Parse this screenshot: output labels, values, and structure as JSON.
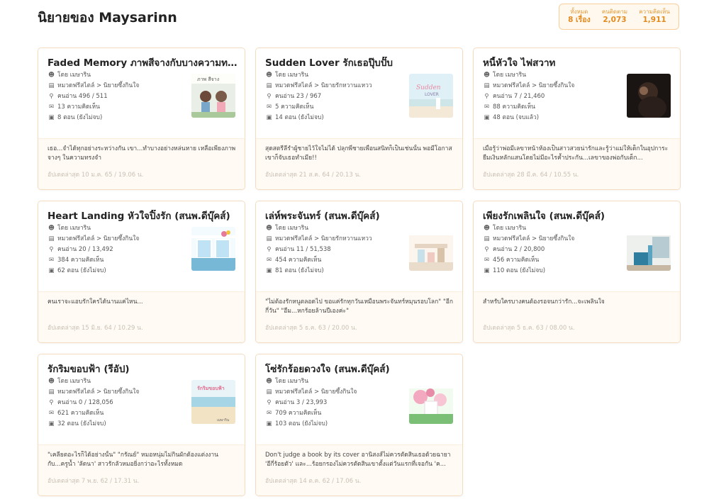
{
  "page": {
    "title": "นิยายของ Maysarinn"
  },
  "stats": [
    {
      "label": "ทั้งหมด",
      "value": "8 เรื่อง"
    },
    {
      "label": "คนติดตาม",
      "value": "2,073"
    },
    {
      "label": "ความคิดเห็น",
      "value": "1,911"
    }
  ],
  "colors": {
    "accent": "#e38a1e",
    "card_border": "#f5dcc0",
    "card_bottom": "#fffaf3"
  },
  "icons": {
    "author": "user-circle-icon",
    "category": "book-icon",
    "readers": "search-icon",
    "comments": "speech-bubble-icon",
    "episodes": "document-icon"
  },
  "novels": [
    {
      "title": "Faded Memory ภาพสีจางกับบางความทรงจำ",
      "author": "โดย เมษาริน",
      "category": "หมวดฟรีสไตล์ > นิยายซึ้งกินใจ",
      "readers": "คนอ่าน 496 / 511",
      "comments": "13 ความคิดเห็น",
      "episodes": "8 ตอน (ยังไม่จบ)",
      "cover_text": "ภาพ สีจาง",
      "description": "เธอ...จำได้ทุกอย่างระหว่างกัน เขา...ทำบางอย่างหล่นหาย เหลือเพียงภาพจางๆ ในความทรงจำ",
      "updated": "อัปเดตล่าสุด 10 ม.ค. 65 / 19.06 น."
    },
    {
      "title": "Sudden Lover รักเธอปุ๊บปั๊บ",
      "author": "โดย เมษาริน",
      "category": "หมวดฟรีสไตล์ > นิยายรักหวานแหวว",
      "readers": "คนอ่าน 23 / 967",
      "comments": "5 ความคิดเห็น",
      "episodes": "14 ตอน (ยังไม่จบ)",
      "cover_text": "Sudden Lover",
      "description": "สุดสตรีลีรำผู้ชายไว้ใจไม่ได้ ปลุกพี่ชายเพื่อนสนิทก็เป็นเช่นนั้น พอมีโอกาสเขาก็จับเธอทำเมีย!!",
      "updated": "อัปเดตล่าสุด 21 ส.ค. 64 / 20.13 น."
    },
    {
      "title": "หนี้หัวใจ ไฟสวาท",
      "author": "โดย เมษาริน",
      "category": "หมวดฟรีสไตล์ > นิยายซึ้งกินใจ",
      "readers": "คนอ่าน 7 / 21,460",
      "comments": "88 ความคิดเห็น",
      "episodes": "48 ตอน (จบแล้ว)",
      "cover_text": "",
      "description": "เมื่อรู้ว่าพ่อมีเลขาหน้าห้องเป็นสาวสวยน่ารักและรู้ว่าแม่ให้เด็กในอุปการะยืมเงินหลักแสนโดยไม่มีอะไรค้ำประกัน...เลขาของพ่อกับเด็ก...",
      "updated": "อัปเดตล่าสุด 28 มี.ค. 64 / 10.55 น."
    },
    {
      "title": "Heart Landing หัวใจปิ๊งรัก (สนพ.ดีบุ๊คส์)",
      "author": "โดย เมษาริน",
      "category": "หมวดฟรีสไตล์ > นิยายซึ้งกินใจ",
      "readers": "คนอ่าน 20 / 13,492",
      "comments": "384 ความคิดเห็น",
      "episodes": "62 ตอน (ยังไม่จบ)",
      "cover_text": "Heart Landing",
      "description": "คนเราจะแอบรักใครได้นานแค่ไหน...",
      "updated": "อัปเดตล่าสุด 15 มิ.ย. 64 / 10.29 น."
    },
    {
      "title": "เล่ห์พระจันทร์ (สนพ.ดีบุ๊คส์)",
      "author": "โดย เมษาริน",
      "category": "หมวดฟรีสไตล์ > นิยายรักหวานแหวว",
      "readers": "คนอ่าน 11 / 51,538",
      "comments": "454 ความคิดเห็น",
      "episodes": "81 ตอน (ยังไม่จบ)",
      "cover_text": "",
      "description": "\"ไม่ต้องรักหนูตลอดไป ขอแค่รักทุกวันเหมือนพระจันทร์หมุนรอบโลก\" \"อีกกี่วัน\" \"อืม...หกร้อยล้านปีเองค่ะ\"",
      "updated": "อัปเดตล่าสุด 5 ธ.ค. 63 / 20.00 น."
    },
    {
      "title": "เพียงรักเพลินใจ (สนพ.ดีบุ๊คส์)",
      "author": "โดย เมษาริน",
      "category": "หมวดฟรีสไตล์ > นิยายซึ้งกินใจ",
      "readers": "คนอ่าน 2 / 20,800",
      "comments": "456 ความคิดเห็น",
      "episodes": "110 ตอน (ยังไม่จบ)",
      "cover_text": "",
      "description": "สำหรับใครบางคนต้องรอจนกว่ารัก...จะเพลินใจ",
      "updated": "อัปเดตล่าสุด 5 ธ.ค. 63 / 08.00 น."
    },
    {
      "title": "รักริมขอบฟ้า (รีอัป)",
      "author": "โดย เมษาริน",
      "category": "หมวดฟรีสไตล์ > นิยายซึ้งกินใจ",
      "readers": "คนอ่าน 0 / 128,056",
      "comments": "621 ความคิดเห็น",
      "episodes": "32 ตอน (ยังไม่จบ)",
      "cover_text": "รักริมขอบฟ้า",
      "description": "\"เคลียตอะไรก็ได้อย่างนั้น\" \"กรัณย์\" หมอหนุ่มไม่กินผักต้องแต่งงานกับ...ครูน้ำ 'ลัดนา' สาวรักลัวหมอยิ่งกว่าอะไรทั้งหมด",
      "updated": "อัปเดตล่าสุด 7 พ.ย. 62 / 17.31 น."
    },
    {
      "title": "โซ่รักร้อยดวงใจ (สนพ.ดีบุ๊คส์)",
      "author": "โดย เมษาริน",
      "category": "หมวดฟรีสไตล์ > นิยายซึ้งกินใจ",
      "readers": "คนอ่าน 3 / 23,993",
      "comments": "709 ความคิดเห็น",
      "episodes": "103 ตอน (ยังไม่จบ)",
      "cover_text": "",
      "description": "Don't judge a book by its cover อานิสงส์ไม่ควรตัดสินเธอด้วยฉายา 'อีกี่ร้อยตัว' และ...ร้อยกรองไม่ควรตัดสินเขาตั้งแต่วันแรกที่เจอกัน 'ค...",
      "updated": "อัปเดตล่าสุด 14 ต.ค. 62 / 17.06 น."
    }
  ]
}
